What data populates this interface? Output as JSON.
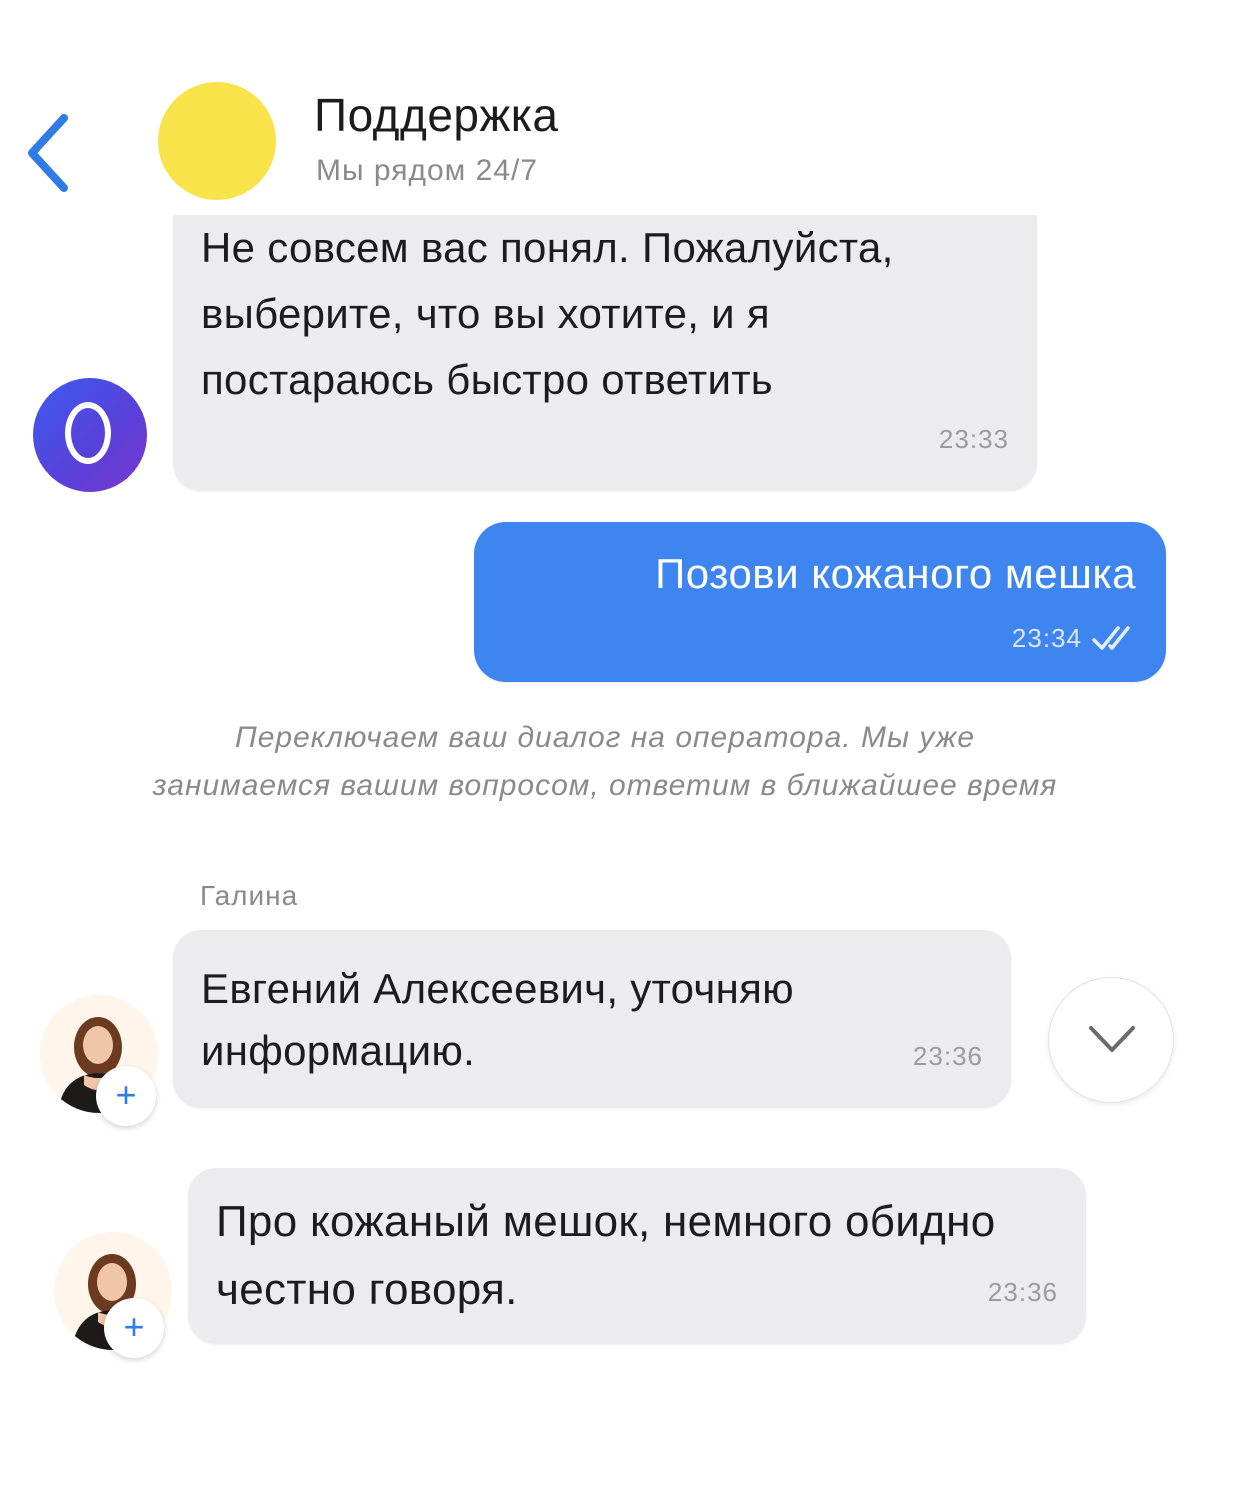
{
  "header": {
    "title": "Поддержка",
    "subtitle": "Мы рядом 24/7",
    "avatar_color": "#f8e44a"
  },
  "messages": [
    {
      "from": "bot",
      "text": "Не совсем вас понял. Пожалуйста, выберите, что вы хотите, и я постараюсь быстро ответить",
      "time": "23:33"
    },
    {
      "from": "me",
      "text": "Позови кожаного мешка",
      "time": "23:34",
      "status_icon": "double-check-icon"
    },
    {
      "from": "operator",
      "text": "Евгений Алексеевич, уточняю информацию.",
      "time": "23:36"
    },
    {
      "from": "operator",
      "text": "Про кожаный мешок, немного обидно честно говоря.",
      "time": "23:36"
    }
  ],
  "system_note": "Переключаем ваш диалог на оператора. Мы уже занимаемся вашим вопросом, ответим в ближайшее время",
  "operator_name": "Галина",
  "plus_label": "+",
  "colors": {
    "outgoing_bubble": "#3f85f0",
    "incoming_bubble": "#ececee",
    "accent": "#2f7be8"
  }
}
